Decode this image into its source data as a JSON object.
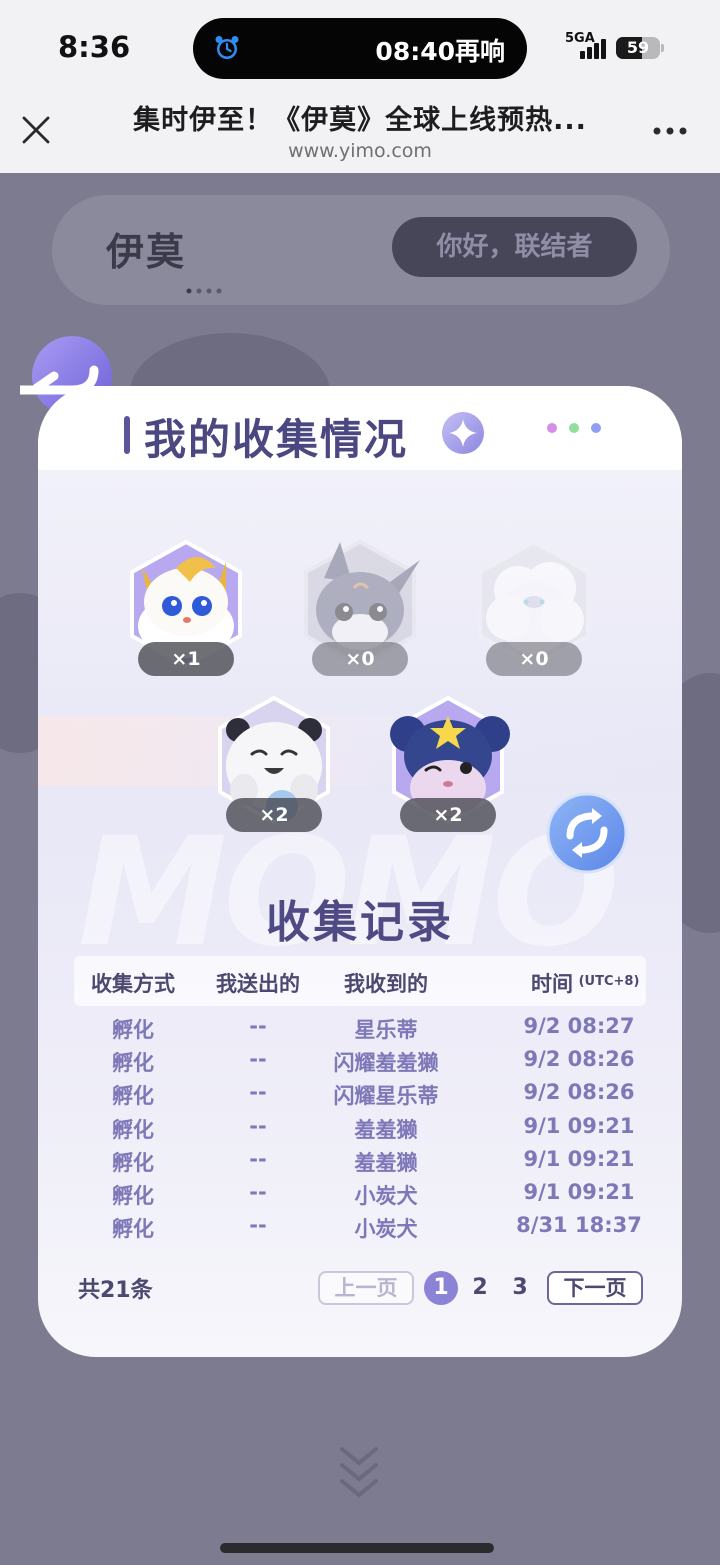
{
  "status_bar": {
    "time": "8:36",
    "alarm_text": "08:40再响",
    "network": "5GA",
    "battery": "59",
    "battery_level": 0.59
  },
  "browser": {
    "title": "集时伊至！《伊莫》全球上线预热...",
    "url": "www.yimo.com"
  },
  "site": {
    "logo": "伊莫",
    "greeting": "你好，联结者"
  },
  "modal": {
    "title": "我的收集情况",
    "pets": [
      {
        "name": "pet-golden-fox",
        "count": "×1",
        "owned": true
      },
      {
        "name": "pet-gray-cat",
        "count": "×0",
        "owned": false
      },
      {
        "name": "pet-white-fluff",
        "count": "×0",
        "owned": false
      },
      {
        "name": "pet-white-badger",
        "count": "×2",
        "owned": true
      },
      {
        "name": "pet-blue-star-mouse",
        "count": "×2",
        "owned": true
      }
    ],
    "records_title": "收集记录",
    "columns": [
      "收集方式",
      "我送出的",
      "我收到的",
      "时间"
    ],
    "time_suffix": "(UTC+8)",
    "rows": [
      [
        "孵化",
        "--",
        "星乐蒂",
        "9/2 08:27"
      ],
      [
        "孵化",
        "--",
        "闪耀羞羞獭",
        "9/2 08:26"
      ],
      [
        "孵化",
        "--",
        "闪耀星乐蒂",
        "9/2 08:26"
      ],
      [
        "孵化",
        "--",
        "羞羞獭",
        "9/1 09:21"
      ],
      [
        "孵化",
        "--",
        "羞羞獭",
        "9/1 09:21"
      ],
      [
        "孵化",
        "--",
        "小炭犬",
        "9/1 09:21"
      ],
      [
        "孵化",
        "--",
        "小炭犬",
        "8/31 18:37"
      ]
    ],
    "total": "共21条",
    "pagination": {
      "prev": "上一页",
      "pages": [
        "1",
        "2",
        "3"
      ],
      "current": "1",
      "next": "下一页"
    }
  },
  "colors": {
    "accent": "#8b83d6",
    "title": "#4b4780",
    "row_text": "#7e78b8"
  }
}
